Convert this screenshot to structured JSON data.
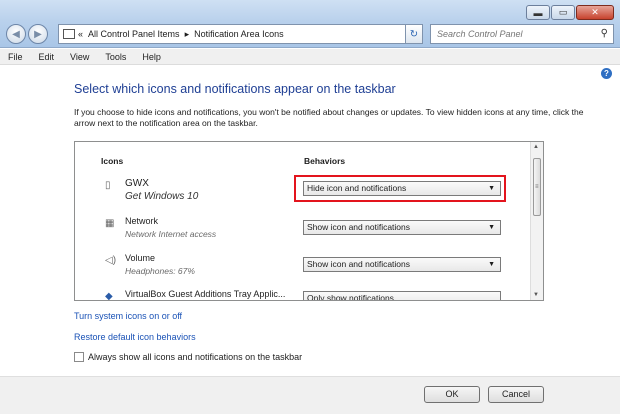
{
  "window": {
    "minimize_glyph": "▬",
    "maximize_glyph": "▭",
    "close_glyph": "✕"
  },
  "address_bar": {
    "overflow": "«",
    "crumbs": [
      "All Control Panel Items",
      "Notification Area Icons"
    ],
    "separator": "▸"
  },
  "search": {
    "placeholder": "Search Control Panel"
  },
  "menu": [
    "File",
    "Edit",
    "View",
    "Tools",
    "Help"
  ],
  "page": {
    "heading": "Select which icons and notifications appear on the taskbar",
    "description": "If you choose to hide icons and notifications, you won't be notified about changes or updates. To view hidden icons at any time, click the arrow next to the notification area on the taskbar."
  },
  "list": {
    "col_icons": "Icons",
    "col_behaviors": "Behaviors",
    "rows": [
      {
        "name": "GWX",
        "sub": "Get Windows 10",
        "behavior": "Hide icon and notifications",
        "icon": "gwx-icon"
      },
      {
        "name": "Network",
        "sub": "Network Internet access",
        "behavior": "Show icon and notifications",
        "icon": "network-icon"
      },
      {
        "name": "Volume",
        "sub": "Headphones: 67%",
        "behavior": "Show icon and notifications",
        "icon": "volume-icon"
      },
      {
        "name": "VirtualBox Guest Additions Tray Applic...",
        "sub": "",
        "behavior": "Only show notifications",
        "icon": "virtualbox-icon"
      }
    ]
  },
  "links": {
    "system_icons": "Turn system icons on or off",
    "restore": "Restore default icon behaviors"
  },
  "checkbox": {
    "label": "Always show all icons and notifications on the taskbar",
    "checked": false
  },
  "buttons": {
    "ok": "OK",
    "cancel": "Cancel"
  },
  "colors": {
    "heading": "#1f3f94",
    "link": "#1a52b6",
    "highlight": "#e3141d"
  }
}
